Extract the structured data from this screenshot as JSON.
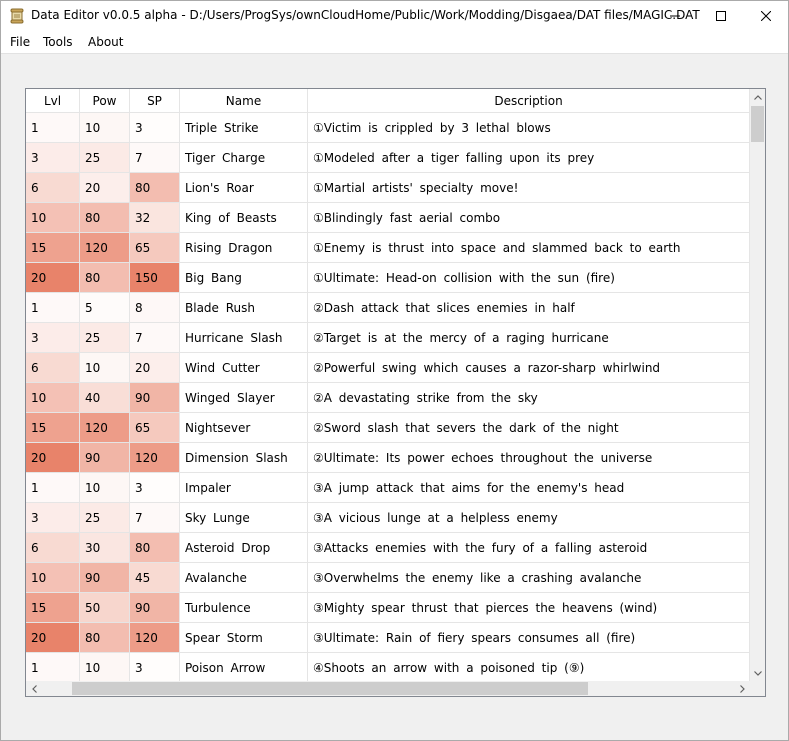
{
  "window": {
    "title": "Data Editor v0.0.5 alpha - D:/Users/ProgSys/ownCloudHome/Public/Work/Modding/Disgaea/DAT files/MAGIC.DAT",
    "minimize_icon": "minimize-icon",
    "maximize_icon": "maximize-icon",
    "close_icon": "close-icon"
  },
  "menu": {
    "file": "File",
    "tools": "Tools",
    "about": "About"
  },
  "table": {
    "columns": [
      "Lvl",
      "Pow",
      "SP",
      "Name",
      "Description"
    ],
    "heat_color": "#e8836a",
    "rows": [
      [
        "1",
        "10",
        "3",
        "Triple Strike",
        "①Victim is crippled by 3 lethal blows"
      ],
      [
        "3",
        "25",
        "7",
        "Tiger Charge",
        "①Modeled after a tiger falling upon its prey"
      ],
      [
        "6",
        "20",
        "80",
        "Lion's Roar",
        "①Martial artists' specialty move!"
      ],
      [
        "10",
        "80",
        "32",
        "King of Beasts",
        "①Blindingly fast aerial combo"
      ],
      [
        "15",
        "120",
        "65",
        "Rising Dragon",
        "①Enemy is thrust into space and slammed back to earth"
      ],
      [
        "20",
        "80",
        "150",
        "Big Bang",
        "①Ultimate: Head-on collision with the sun (fire)"
      ],
      [
        "1",
        "5",
        "8",
        "Blade Rush",
        "②Dash attack that slices enemies in half"
      ],
      [
        "3",
        "25",
        "7",
        "Hurricane Slash",
        "②Target is at the mercy of a raging hurricane"
      ],
      [
        "6",
        "10",
        "20",
        "Wind Cutter",
        "②Powerful swing which causes a razor-sharp whirlwind"
      ],
      [
        "10",
        "40",
        "90",
        "Winged Slayer",
        "②A devastating strike from the sky"
      ],
      [
        "15",
        "120",
        "65",
        "Nightsever",
        "②Sword slash that severs the dark of the night"
      ],
      [
        "20",
        "90",
        "120",
        "Dimension Slash",
        "②Ultimate: Its power echoes throughout the universe"
      ],
      [
        "1",
        "10",
        "3",
        "Impaler",
        "③A jump attack that aims for the enemy's head"
      ],
      [
        "3",
        "25",
        "7",
        "Sky Lunge",
        "③A vicious lunge at a helpless enemy"
      ],
      [
        "6",
        "30",
        "80",
        "Asteroid Drop",
        "③Attacks enemies with the fury of a falling asteroid"
      ],
      [
        "10",
        "90",
        "45",
        "Avalanche",
        "③Overwhelms the enemy like a crashing avalanche"
      ],
      [
        "15",
        "50",
        "90",
        "Turbulence",
        "③Mighty spear thrust that pierces the heavens (wind)"
      ],
      [
        "20",
        "80",
        "120",
        "Spear Storm",
        "③Ultimate: Rain of fiery spears consumes all (fire)"
      ],
      [
        "1",
        "10",
        "3",
        "Poison Arrow",
        "④Shoots an arrow with a poisoned tip (⑨)"
      ]
    ]
  },
  "scrollbars": {
    "up_icon": "chevron-up-icon",
    "down_icon": "chevron-down-icon",
    "left_icon": "chevron-left-icon",
    "right_icon": "chevron-right-icon"
  }
}
